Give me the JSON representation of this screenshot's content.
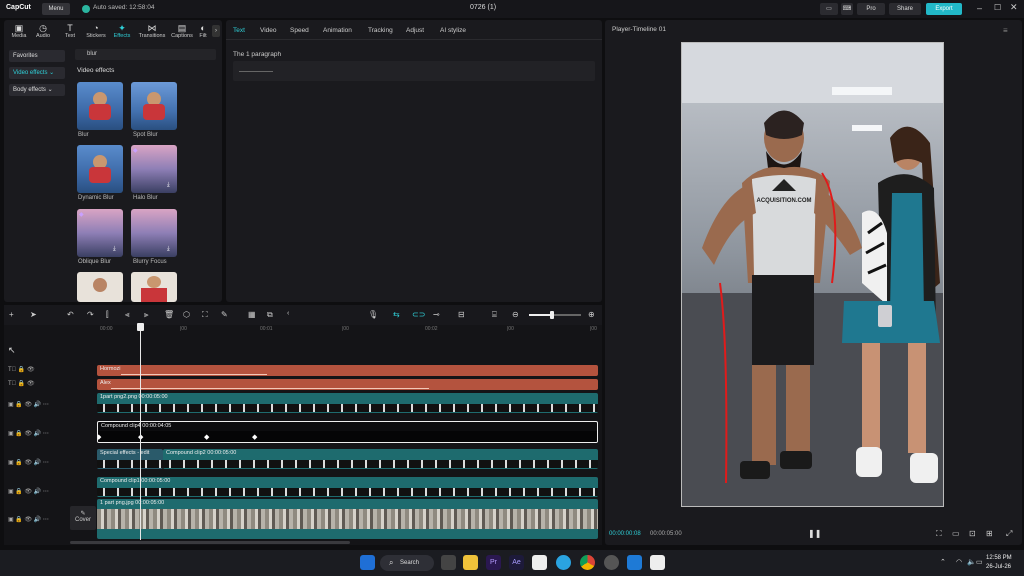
{
  "titlebar": {
    "app_name": "CapCut",
    "menu_label": "Menu",
    "autosave_text": "Auto saved: 12:58:04",
    "project_title": "0726 (1)",
    "pro_label": "Pro",
    "share_label": "Share",
    "export_label": "Export"
  },
  "media_tabs": [
    {
      "label": "Media",
      "icon": "media-icon"
    },
    {
      "label": "Audio",
      "icon": "audio-icon"
    },
    {
      "label": "Text",
      "icon": "text-icon"
    },
    {
      "label": "Stickers",
      "icon": "stickers-icon"
    },
    {
      "label": "Effects",
      "icon": "effects-icon",
      "active": true
    },
    {
      "label": "Transitions",
      "icon": "transitions-icon"
    },
    {
      "label": "Captions",
      "icon": "captions-icon"
    },
    {
      "label": "Filt",
      "icon": "filters-icon"
    }
  ],
  "effects_sidebar": {
    "favorites": "Favorites",
    "video_effects": "Video effects",
    "body_effects": "Body effects"
  },
  "search": {
    "value": "blur"
  },
  "effects_section_title": "Video effects",
  "effects": [
    {
      "label": "Blur"
    },
    {
      "label": "Spot Blur"
    },
    {
      "label": "Dynamic Blur"
    },
    {
      "label": "Halo Blur"
    },
    {
      "label": "Oblique Blur"
    },
    {
      "label": "Blurry Focus"
    }
  ],
  "inspector": {
    "tabs": [
      "Text",
      "Video",
      "Speed",
      "Animation",
      "Tracking",
      "Adjust",
      "AI stylize"
    ],
    "active_tab": "Text",
    "paragraph_label": "The 1 paragraph"
  },
  "player": {
    "title": "Player-Timeline 01",
    "current_time": "00:00:00:08",
    "total_time": "00:00:05:00",
    "shirt_text": "ACQUISITION.COM"
  },
  "timeline": {
    "ruler_ticks": [
      "00:00",
      "|00",
      "|00",
      "00:01",
      "|00",
      "00:02",
      "|00",
      "|00"
    ],
    "cover_label": "Cover",
    "clips": [
      {
        "label": "Hormozi",
        "kind": "text"
      },
      {
        "label": "Alex",
        "kind": "text"
      },
      {
        "label": "1part png2.png   00:00:05:00",
        "kind": "video"
      },
      {
        "label": "Compound clip4   00:00:04:05",
        "kind": "compound"
      },
      {
        "label": "Special effects - edit",
        "kind": "effect"
      },
      {
        "label": "Compound clip2   00:00:05:00",
        "kind": "compound"
      },
      {
        "label": "Compound clip1   00:00:05:00",
        "kind": "compound"
      },
      {
        "label": "1 part png.jpg   00:00:05:00",
        "kind": "main"
      }
    ]
  },
  "taskbar": {
    "search_label": "Search",
    "time": "12:58 PM",
    "date": "26-Jul-26"
  },
  "colors": {
    "accent": "#2fd0d8",
    "text_clip": "#b4533e",
    "video_clip": "#1e6b6e"
  }
}
